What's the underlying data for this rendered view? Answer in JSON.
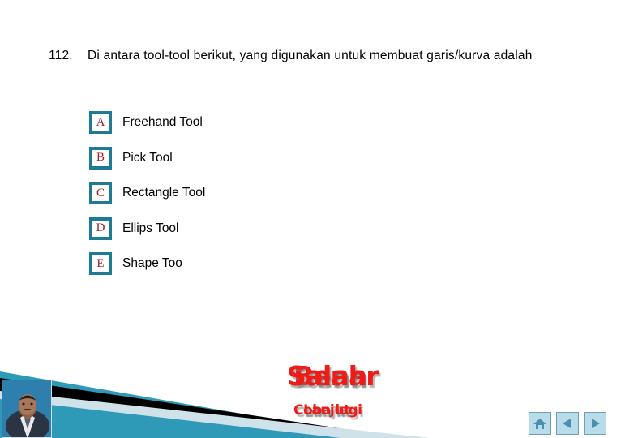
{
  "slide": {
    "question": {
      "number": "112.",
      "text": "Di antara tool-tool berikut, yang digunakan untuk membuat garis/kurva adalah"
    },
    "options": [
      {
        "letter": "A",
        "label": "Freehand Tool"
      },
      {
        "letter": "B",
        "label": "Pick Tool"
      },
      {
        "letter": "C",
        "label": "Rectangle Tool"
      },
      {
        "letter": "D",
        "label": "Ellips Tool"
      },
      {
        "letter": "E",
        "label": "Shape Too"
      }
    ],
    "feedback": {
      "wrong_title": "Salah",
      "correct_title": "Benar",
      "wrong_subtitle": "Coba lagi",
      "correct_subtitle": "Lanjut"
    },
    "nav": {
      "home_label": "Home",
      "previous_label": "Previous",
      "next_label": "Next"
    },
    "colors": {
      "badge_border": "#1f7a94",
      "badge_letter": "#9e2228",
      "feedback_red": "#ee1b17",
      "banner_teal": "#2e9ab8",
      "banner_black": "#000000",
      "banner_pale": "#cfe2ea",
      "nav_button_face": "#b9dcea",
      "nav_glyph": "#4a8fb0"
    }
  }
}
